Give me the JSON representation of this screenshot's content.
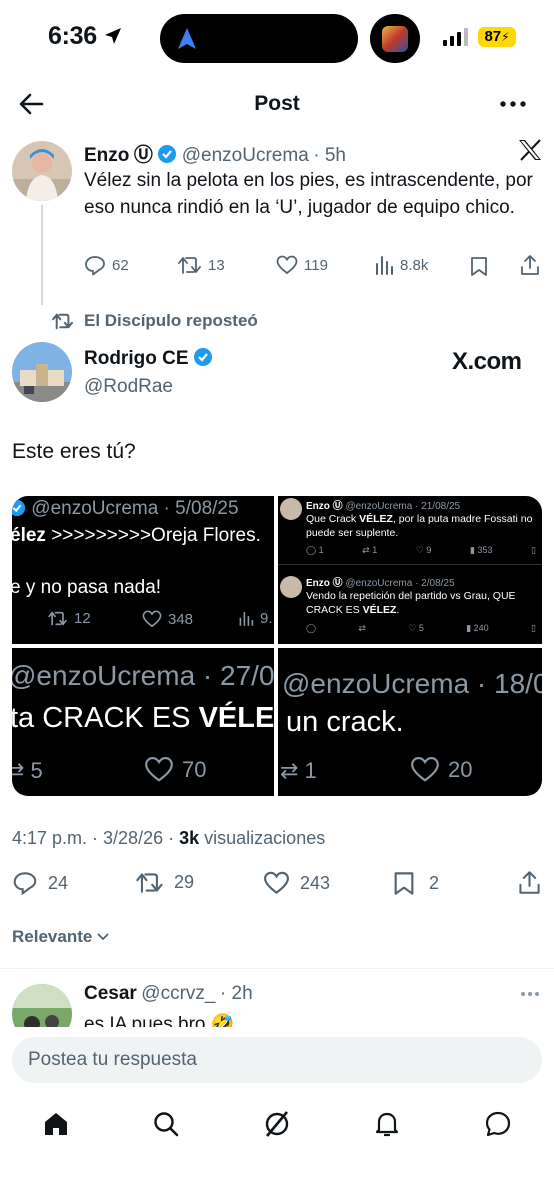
{
  "status_bar": {
    "time": "6:36",
    "battery": "87"
  },
  "header": {
    "title": "Post"
  },
  "quoted_tweet": {
    "author_name": "Enzo",
    "author_symbol": "Ⓤ",
    "handle": "@enzoUcrema",
    "time": "· 5h",
    "text": "Vélez sin la pelota en los pies, es intrascendente, por eso nunca rindió en la ‘U’, jugador de equipo chico.",
    "replies": "62",
    "reposts": "13",
    "likes": "119",
    "views": "8.8k"
  },
  "repost_label": "El Discípulo reposteó",
  "main_tweet": {
    "author_name": "Rodrigo CE",
    "handle": "@RodRae",
    "brand": "X.com",
    "text": "Este eres tú?",
    "timestamp": "4:17 p.m. · 3/28/26 ·",
    "views_count": "3k",
    "views_label": "visualizaciones",
    "replies": "24",
    "reposts": "29",
    "likes": "243",
    "bookmarks": "2"
  },
  "media": {
    "cell1": {
      "handle": "@enzoUcrema · 5/08/25",
      "line1_bold": "élez",
      "line1_rest": " >>>>>>>>>Oreja Flores.",
      "line2": "e y no pasa nada!",
      "reposts": "12",
      "likes": "348",
      "views": "9."
    },
    "cell2a": {
      "name": "Enzo Ⓤ",
      "handle": "@enzoUcrema · 21/08/25",
      "text_pre": "Que Crack ",
      "text_bold": "VÉLEZ",
      "text_post": ", por la puta madre Fossati no puede ser suplente.",
      "replies": "1",
      "reposts": "1",
      "likes": "9",
      "views": "353"
    },
    "cell2b": {
      "name": "Enzo Ⓤ",
      "handle": "@enzoUcrema · 2/08/25",
      "text_pre": "Vendo la repetición del partido vs Grau, QUE CRACK ES ",
      "text_bold": "VÉLEZ",
      "text_post": ".",
      "likes": "5",
      "views": "240"
    },
    "cell3": {
      "handle": "@enzoUcrema · 27/0",
      "text_pre": "ta CRACK ES ",
      "text_bold": "VÉLE",
      "reposts": "5",
      "likes": "70"
    },
    "cell4": {
      "handle": "@enzoUcrema · 18/0",
      "text": "un crack.",
      "reposts": "1",
      "likes": "20"
    }
  },
  "filter": {
    "label": "Relevante"
  },
  "reply": {
    "author_name": "Cesar",
    "handle": "@ccrvz_",
    "time": "· 2h",
    "text": "es IA pues bro 🤣"
  },
  "composer": {
    "placeholder": "Postea tu respuesta"
  },
  "nav": [
    "home-icon",
    "search-icon",
    "grok-icon",
    "notifications-icon",
    "messages-icon"
  ]
}
